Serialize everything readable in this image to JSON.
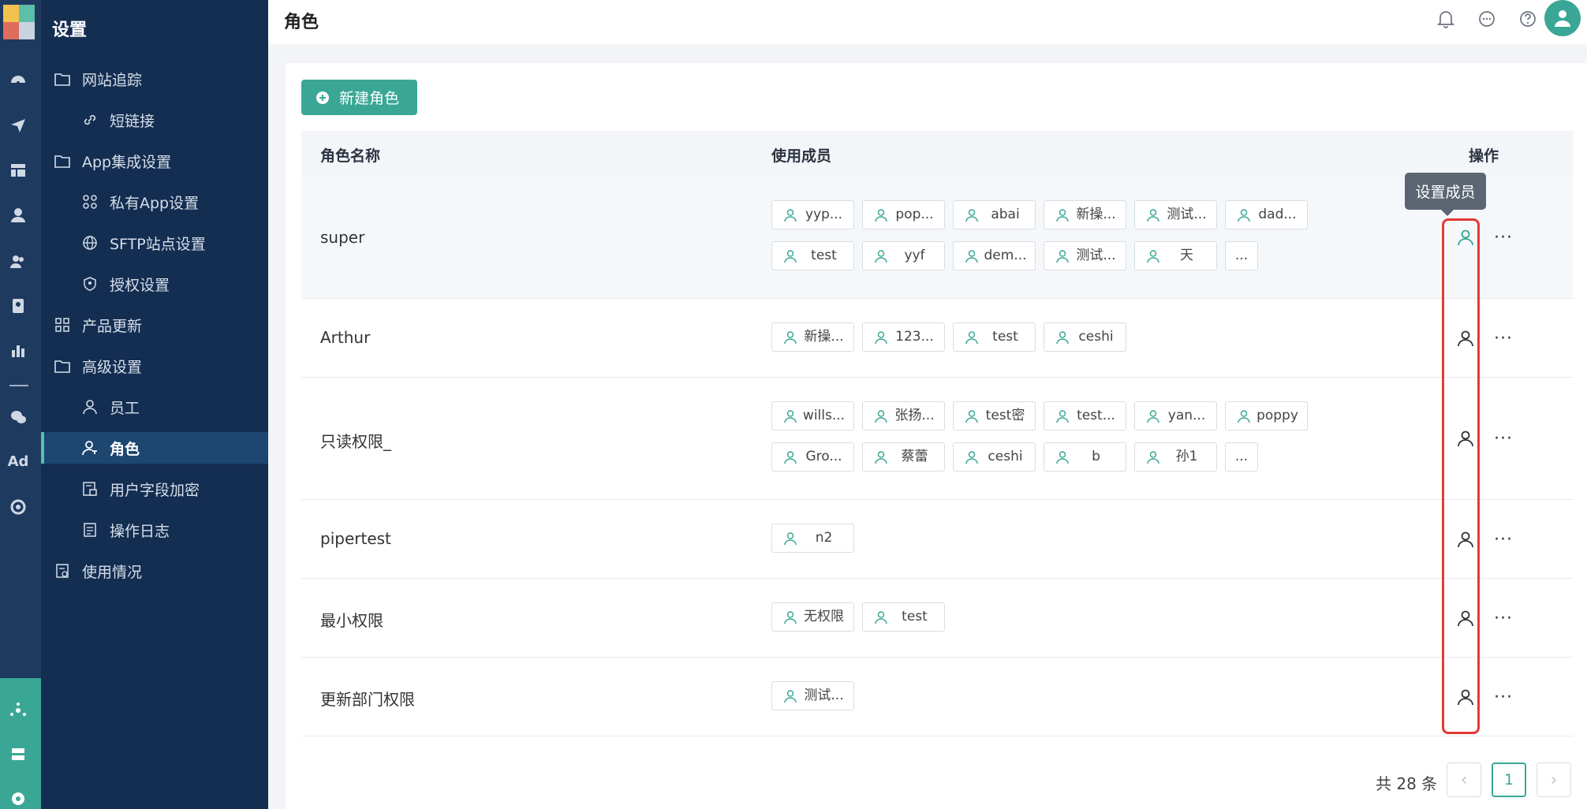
{
  "sidebar": {
    "title": "设置",
    "items": [
      {
        "label": "网站追踪",
        "icon": "folder-icon"
      },
      {
        "label": "短链接",
        "icon": "link-icon"
      },
      {
        "label": "App集成设置",
        "icon": "folder-icon"
      },
      {
        "label": "私有App设置",
        "icon": "grid-icon"
      },
      {
        "label": "SFTP站点设置",
        "icon": "globe-icon"
      },
      {
        "label": "授权设置",
        "icon": "shield-icon"
      },
      {
        "label": "产品更新",
        "icon": "apps-icon"
      },
      {
        "label": "高级设置",
        "icon": "folder-icon"
      },
      {
        "label": "员工",
        "icon": "user-icon"
      },
      {
        "label": "角色",
        "icon": "user-key-icon",
        "active": true
      },
      {
        "label": "用户字段加密",
        "icon": "lock-doc-icon"
      },
      {
        "label": "操作日志",
        "icon": "log-icon"
      },
      {
        "label": "使用情况",
        "icon": "report-icon"
      }
    ]
  },
  "rail": {
    "ad_label": "Ad"
  },
  "header": {
    "title": "角色"
  },
  "toolbar": {
    "new_role_label": "新建角色"
  },
  "table": {
    "columns": {
      "name": "角色名称",
      "members": "使用成员",
      "actions": "操作"
    },
    "rows": [
      {
        "name": "super",
        "members": [
          "yyp...",
          "pop...",
          "abai",
          "新操...",
          "测试...",
          "dad...",
          "test",
          "yyf",
          "dem...",
          "测试...",
          "天"
        ],
        "more": "..."
      },
      {
        "name": "Arthur",
        "members": [
          "新操...",
          "123...",
          "test",
          "ceshi"
        ]
      },
      {
        "name": "只读权限_",
        "members": [
          "wills...",
          "张扬...",
          "test密",
          "test...",
          "yan...",
          "poppy",
          "Gro...",
          "蔡蕾",
          "ceshi",
          "b",
          "孙1"
        ],
        "more": "..."
      },
      {
        "name": "pipertest",
        "members": [
          "n2"
        ]
      },
      {
        "name": "最小权限",
        "members": [
          "无权限",
          "test"
        ]
      },
      {
        "name": "更新部门权限",
        "members": [
          "测试..."
        ]
      }
    ],
    "more_glyph": "···"
  },
  "tooltip": {
    "label": "设置成员"
  },
  "pagination": {
    "total_label": "共 28 条",
    "current_page": "1",
    "prev": "‹",
    "next": "›"
  },
  "colors": {
    "accent": "#3aa796",
    "sidebar": "#142e52",
    "rail": "#1f3a5f",
    "highlight_box": "#e53935"
  }
}
